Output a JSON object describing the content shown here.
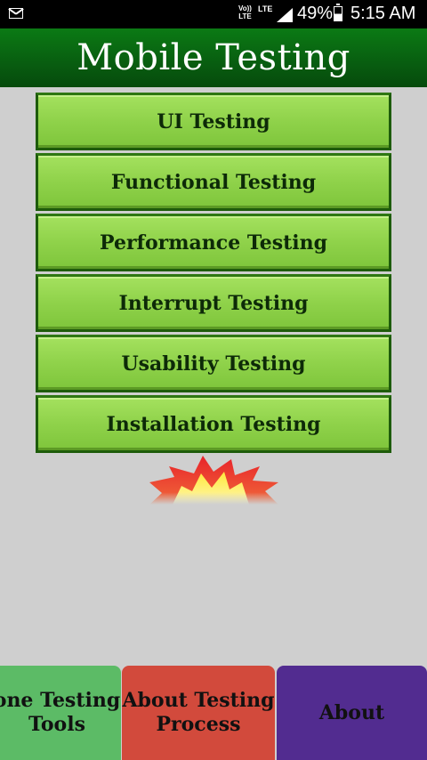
{
  "status_bar": {
    "volte_top": "Vo))",
    "volte_bottom": "LTE",
    "lte": "LTE",
    "battery": "49%",
    "time": "5:15 AM"
  },
  "header": {
    "title": "Mobile Testing"
  },
  "menu": {
    "items": [
      {
        "label": "UI Testing"
      },
      {
        "label": "Functional Testing"
      },
      {
        "label": "Performance Testing"
      },
      {
        "label": "Interrupt Testing"
      },
      {
        "label": "Usability Testing"
      },
      {
        "label": "Installation Testing"
      }
    ]
  },
  "bottom_nav": {
    "tools_line1": "one Testing",
    "tools_line2": "Tools",
    "process_line1": "About Testing",
    "process_line2": "Process",
    "about": "About"
  },
  "colors": {
    "header_green": "#085d10",
    "button_green": "#8fd24a",
    "nav_tools": "#5cbb66",
    "nav_process": "#d24a3c",
    "nav_about": "#522c90"
  }
}
